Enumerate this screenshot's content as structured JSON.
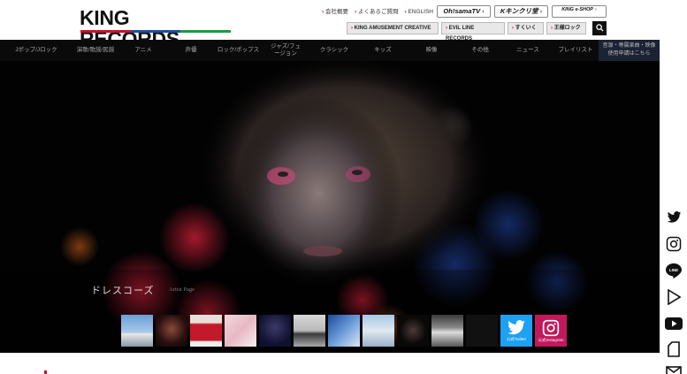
{
  "header": {
    "logo": "KING RECORDS",
    "toplinks": [
      "会社概要",
      "よくあるご質問",
      "ENGLISH"
    ],
    "badges": {
      "ohsama": "Oh!samaTV",
      "kingkurabu": "Kキンクリ堂",
      "eshop": "KING e-SHOP"
    },
    "sublinks": [
      "KING AMUSEMENT CREATIVE",
      "EVIL LINE RECORDS",
      "すくいく",
      "王様ロック"
    ],
    "search_icon": "magnifier-icon"
  },
  "nav": {
    "items": [
      "Jポップ/Jロック",
      "演歌/歌謡/民謡",
      "アニメ",
      "声優",
      "ロック/ポップス",
      "ジャズ/フュージョン",
      "クラシック",
      "キッズ",
      "映像",
      "その他",
      "ニュース",
      "プレイリスト"
    ],
    "note": "音源・専属楽曲・映像使用申請はこちら"
  },
  "artist": {
    "name": "ドレスコーズ",
    "sub": "Artist Page"
  },
  "thumbs": {
    "twitter_label": "公式Twitter",
    "instagram_label": "公式Instagram"
  },
  "colors": {
    "brand_red": "#c8102e",
    "brand_blue": "#1d4ea0",
    "brand_green": "#1a9a45",
    "twitter": "#1da1f2",
    "instagram": "#c2185b"
  },
  "rail": {
    "icons": [
      "twitter-icon",
      "instagram-icon",
      "line-icon",
      "play-icon",
      "youtube-icon",
      "tiktok-icon",
      "mail-icon"
    ]
  }
}
